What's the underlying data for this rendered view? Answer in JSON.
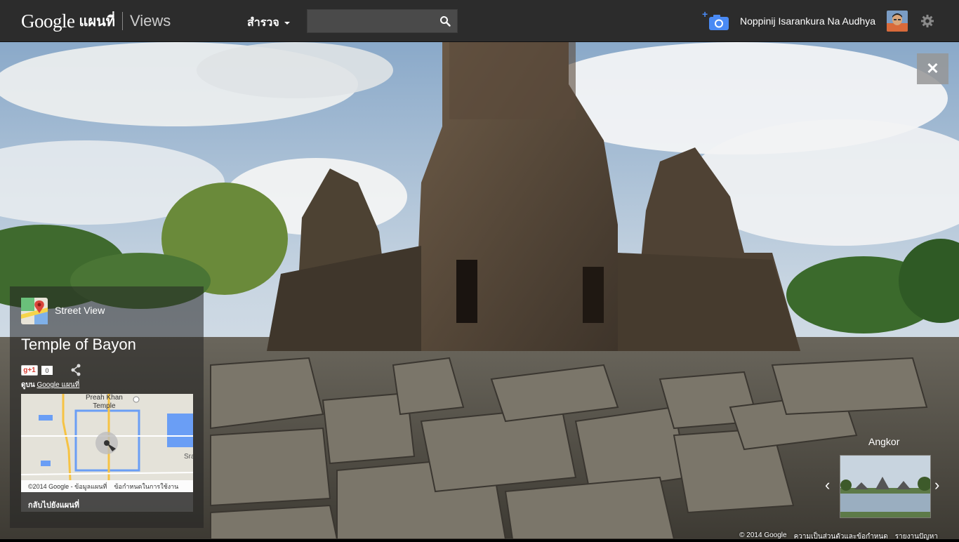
{
  "header": {
    "logo_google": "Google",
    "logo_maps": "แผนที่",
    "logo_views": "Views",
    "explore_label": "สำรวจ",
    "search_placeholder": "",
    "search_icon": "search-icon",
    "camera_icon": "add-photo-camera-icon",
    "user_name": "Noppinij Isarankura Na Audhya",
    "settings_icon": "gear-icon"
  },
  "close_label": "✕",
  "panel": {
    "street_view_label": "Street View",
    "place_title": "Temple of Bayon",
    "plus_one_label": "g+1",
    "plus_one_count": "0",
    "view_on_prefix": "ดูบน",
    "view_on_link": "Google แผนที่",
    "map": {
      "label_line1": "Preah Khan",
      "label_line2": "Temple",
      "label_sra": "Sra",
      "credit": "©2014 Google - ข้อมูลแผนที่",
      "terms": "ข้อกำหนดในการใช้งาน"
    },
    "back_to_map": "กลับไปยังแผนที่"
  },
  "related": {
    "title": "Angkor",
    "prev": "‹",
    "next": "›"
  },
  "footer": {
    "copyright": "© 2014 Google",
    "privacy": "ความเป็นส่วนตัวและข้อกำหนด",
    "report": "รายงานปัญหา"
  },
  "colors": {
    "topbar": "#2c2c2c",
    "camera_blue": "#4a8af4",
    "route_yellow": "#f6c344",
    "water_blue": "#6a9ef5"
  }
}
